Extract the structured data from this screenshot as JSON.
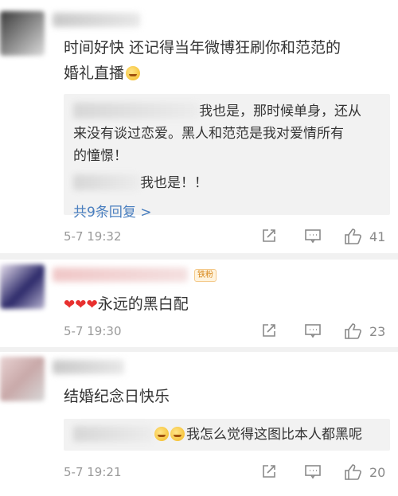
{
  "comments": [
    {
      "text": "时间好快 还记得当年微博狂刷你和范范的婚礼直播",
      "text_line1": "时间好快 还记得当年微博狂刷你和范范的",
      "text_line2": "婚礼直播",
      "replies": [
        {
          "text_line1": "我也是，那时候单身，还从",
          "text_line2": "来没有谈过恋爱。黑人和范范是我对爱情所有",
          "text_line3": "的憧憬！"
        },
        {
          "text": "我也是！！"
        }
      ],
      "more_replies": "共9条回复 >",
      "time": "5-7 19:32",
      "likes": "41"
    },
    {
      "badge": "铁粉",
      "hearts": "❤❤❤",
      "text": "永远的黑白配",
      "time": "5-7 19:30",
      "likes": "23"
    },
    {
      "text": "结婚纪念日快乐",
      "reply": "我怎么觉得这图比本人都黑呢",
      "time": "5-7 19:21",
      "likes": "20"
    }
  ],
  "colors": {
    "link": "#4a7fbf",
    "meta": "#9a9a9a",
    "heart": "#e8302f"
  },
  "icons": [
    "share-icon",
    "comment-icon",
    "like-icon",
    "laugh-emoji-icon"
  ]
}
